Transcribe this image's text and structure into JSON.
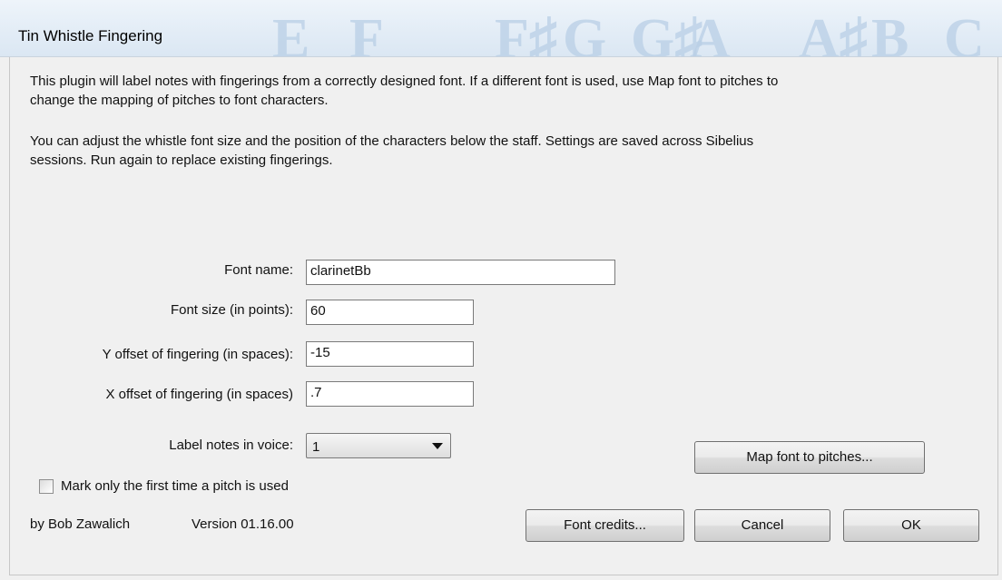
{
  "window": {
    "title": "Tin Whistle Fingering",
    "watermark_notes": [
      "E",
      "F",
      "F♯",
      "G",
      "G♯",
      "A",
      "A♯",
      "B",
      "C"
    ]
  },
  "description": {
    "para1_line1": "This plugin will label notes with fingerings from a correctly designed font. If a different font is used, use Map font to pitches to",
    "para1_line2": "change the mapping of pitches to font characters.",
    "para2_line1": "You can adjust the whistle font size and the position of the characters below the staff. Settings are saved across Sibelius",
    "para2_line2": "sessions. Run again to replace existing fingerings."
  },
  "form": {
    "font_name_label": "Font name:",
    "font_name_value": "clarinetBb",
    "font_size_label": "Font size (in points):",
    "font_size_value": "60",
    "y_offset_label": "Y offset of fingering (in spaces):",
    "y_offset_value": "-15",
    "x_offset_label": "X offset of fingering (in spaces)",
    "x_offset_value": ".7",
    "voice_label": "Label notes in voice:",
    "voice_value": "1",
    "first_time_label": "Mark only the first time a pitch is used"
  },
  "footer": {
    "author": "by Bob Zawalich",
    "version": "Version 01.16.00"
  },
  "buttons": {
    "map_font": "Map font to pitches...",
    "font_credits": "Font credits...",
    "cancel": "Cancel",
    "ok": "OK"
  }
}
